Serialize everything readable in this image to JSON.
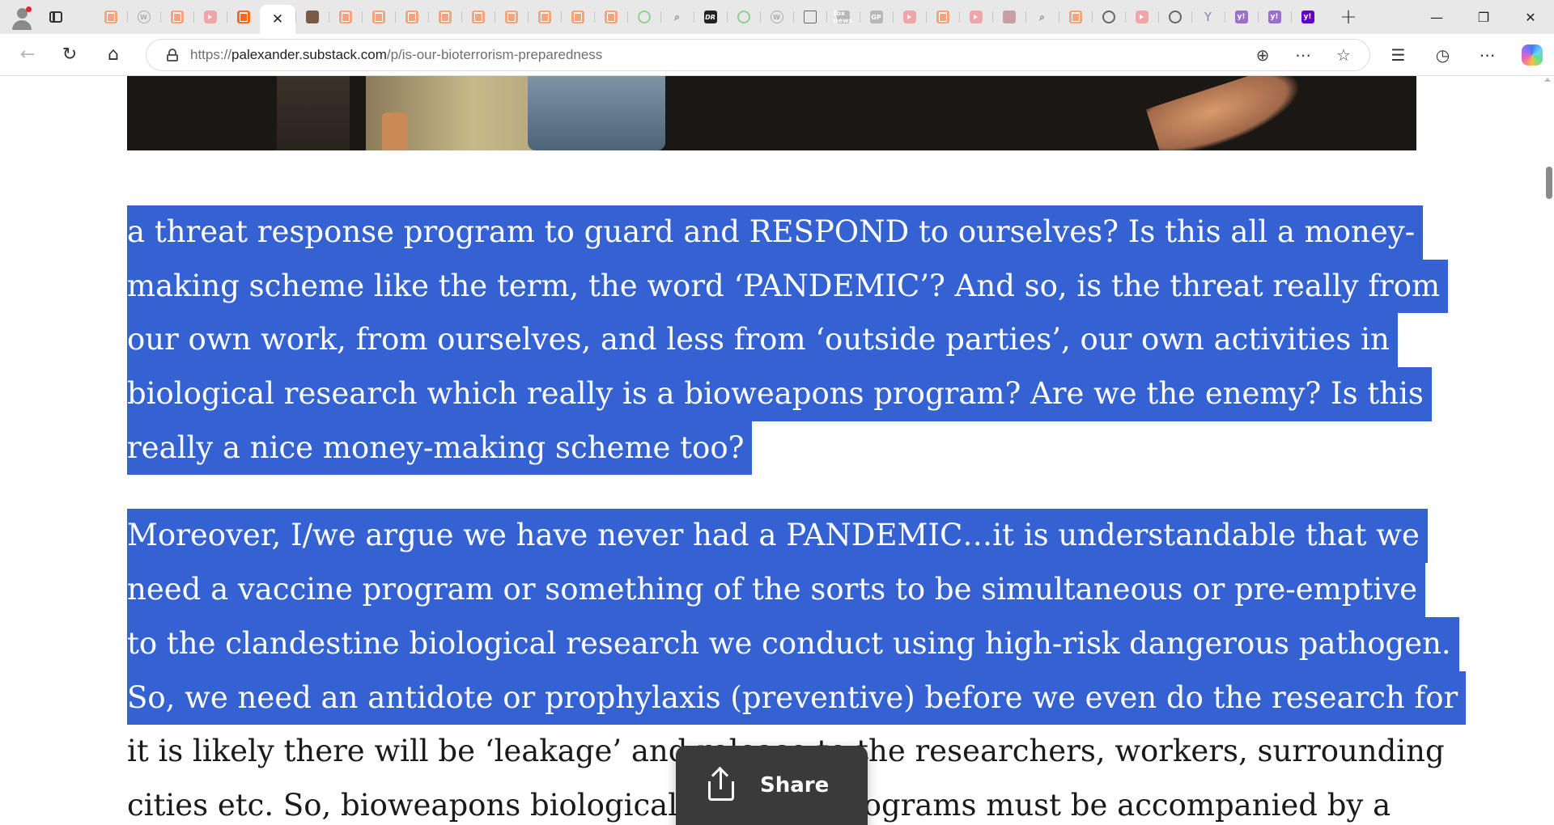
{
  "browser": {
    "url_prefix": "https://",
    "url_host": "palexander.substack.com",
    "url_path": "/p/is-our-bioterrorism-preparedness",
    "tab_favicons": [
      "substack",
      "wordpress",
      "substack",
      "youtube",
      "substack-active",
      "current",
      "photo",
      "substack",
      "substack",
      "substack",
      "substack",
      "substack",
      "substack",
      "substack",
      "substack",
      "substack",
      "play",
      "search",
      "dr",
      "play",
      "wordpress",
      "doc",
      "foxnews",
      "gp",
      "youtube",
      "substack",
      "youtube",
      "book",
      "search",
      "substack",
      "circle",
      "youtube",
      "circle-bar",
      "y",
      "yahoo",
      "yahoo",
      "yahoo-active"
    ],
    "fav_text": {
      "dr": "DR",
      "fox": "fox news",
      "gp": "GP",
      "y": "Y",
      "yahoo": "y!",
      "wp": "W"
    },
    "window_controls": {
      "minimize": "—",
      "restore": "❐",
      "close": "✕"
    }
  },
  "article": {
    "paragraph1": [
      "a threat response program to guard and RESPOND to ourselves? Is this all a money-",
      "making scheme like the term, the word ‘PANDEMIC’? And so, is the threat really from",
      "our own work, from ourselves, and less from ‘outside parties’, our own activities in",
      "biological research which really is a bioweapons program? Are we the enemy? Is this",
      "really a nice money-making scheme too?"
    ],
    "paragraph2_selected": [
      "Moreover, I/we argue we have never had a PANDEMIC…it is understandable that we",
      "need a vaccine program or something of the sorts to be simultaneous or pre-emptive",
      "to the clandestine biological research we conduct using high-risk dangerous pathogen.",
      "So, we need an antidote or prophylaxis (preventive) before we even do the research for"
    ],
    "paragraph2_unselected": [
      "it is likely there will be ‘leakage’ and release to the researchers, workers, surrounding",
      "cities etc. So, bioweapons biological research programs must be accompanied by a"
    ]
  },
  "share_button": {
    "label": "Share"
  }
}
